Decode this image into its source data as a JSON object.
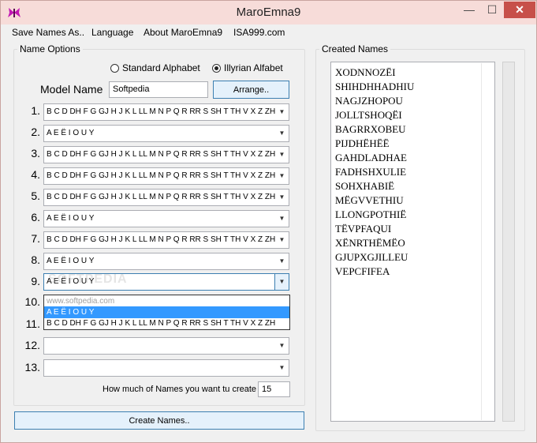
{
  "window": {
    "title": "MaroEmna9",
    "minimize": "—",
    "maximize": "☐",
    "close": "✕"
  },
  "menu": [
    "Save Names As..",
    "Language",
    "About MaroEmna9",
    "ISA999.com"
  ],
  "name_options": {
    "legend": "Name Options",
    "radio_standard": "Standard Alphabet",
    "radio_illyrian": "Illyrian Alfabet",
    "selected": "Illyrian Alfabet",
    "model_label": "Model Name",
    "model_value": "Softpedia",
    "arrange_button": "Arrange..",
    "rows": [
      {
        "num": "1.",
        "value": "B C D DH F G GJ H J K L LL M N P Q R RR S SH T TH V X Z ZH"
      },
      {
        "num": "2.",
        "value": "A E Ë I O U Y"
      },
      {
        "num": "3.",
        "value": "B C D DH F G GJ H J K L LL M N P Q R RR S SH T TH V X Z ZH"
      },
      {
        "num": "4.",
        "value": "B C D DH F G GJ H J K L LL M N P Q R RR S SH T TH V X Z ZH"
      },
      {
        "num": "5.",
        "value": "B C D DH F G GJ H J K L LL M N P Q R RR S SH T TH V X Z ZH"
      },
      {
        "num": "6.",
        "value": "A E Ë I O U Y"
      },
      {
        "num": "7.",
        "value": "B C D DH F G GJ H J K L LL M N P Q R RR S SH T TH V X Z ZH"
      },
      {
        "num": "8.",
        "value": "A E Ë I O U Y"
      },
      {
        "num": "9.",
        "value": "A E Ë I O U Y"
      },
      {
        "num": "10.",
        "value": ""
      },
      {
        "num": "11.",
        "value": ""
      },
      {
        "num": "12.",
        "value": ""
      },
      {
        "num": "13.",
        "value": ""
      }
    ],
    "dropdown_options": [
      "www.softpedia.com",
      "A E Ë I O U Y",
      "B C D DH F G GJ H J K L LL M N P Q R RR S SH T TH V X Z ZH"
    ],
    "watermark": "SOFTPEDIA",
    "count_label": "How much of Names you want tu create",
    "count_value": "15"
  },
  "create_button": "Create Names..",
  "created_names": {
    "legend": "Created Names",
    "items": [
      "XODNNOZËI",
      "SHIHDHHADHIU",
      "NAGJZHOPOU",
      "JOLLTSHOQËI",
      "BAGRRXOBEU",
      "PIJDHËHËË",
      "GAHDLADHAE",
      "FADHSHXULIE",
      "SOHXHABIË",
      "MËGVVETHIU",
      "LLONGPOTHIË",
      "TËVPFAQUI",
      "XËNRTHËMËO",
      "GJUPXGJILLEU",
      "VEPCFIFEA"
    ]
  },
  "colors": {
    "titlebar": "#f7dcd9",
    "close_button": "#c7504a",
    "selection": "#3399ff",
    "button_bg": "#e5f1fb",
    "button_border": "#3c7fb1"
  },
  "icons": {
    "app": "butterfly-icon",
    "combo": "chevron-down-icon"
  }
}
